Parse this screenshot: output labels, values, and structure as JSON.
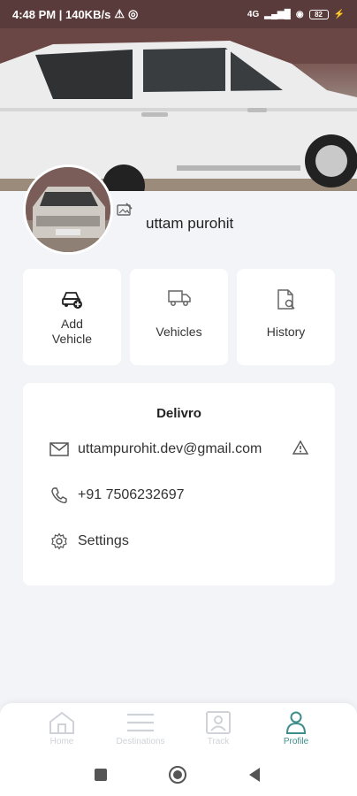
{
  "status_bar": {
    "time_speed": "4:48 PM | 140KB/s",
    "network": "4G",
    "battery": "82"
  },
  "profile": {
    "name": "uttam purohit"
  },
  "tiles": [
    {
      "label_line1": "Add",
      "label_line2": "Vehicle",
      "icon": "add-vehicle-icon"
    },
    {
      "label": "Vehicles",
      "icon": "truck-icon"
    },
    {
      "label": "History",
      "icon": "document-search-icon"
    }
  ],
  "info": {
    "title": "Delivro",
    "email": "uttampurohit.dev@gmail.com",
    "phone": "+91 7506232697",
    "settings": "Settings"
  },
  "bottom_nav": {
    "items": [
      {
        "label": "Home",
        "icon": "home-icon"
      },
      {
        "label": "Destinations",
        "icon": "list-icon"
      },
      {
        "label": "Track",
        "icon": "track-icon"
      },
      {
        "label": "Profile",
        "icon": "profile-icon",
        "active": true
      }
    ]
  },
  "colors": {
    "accent": "#3d8d8a",
    "background": "#f3f4f8"
  }
}
